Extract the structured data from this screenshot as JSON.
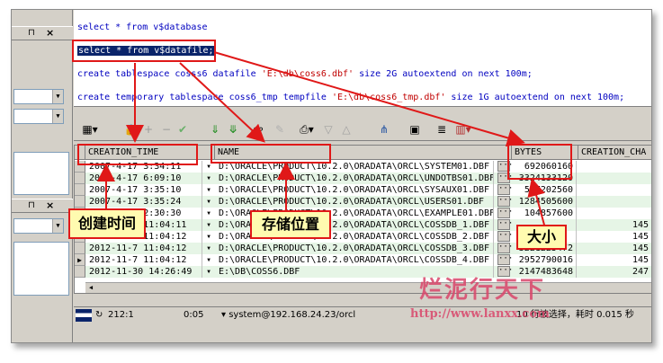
{
  "sql_editor": {
    "lines": [
      {
        "text": "select * from v$database"
      },
      {
        "text": "select * from v$datafile;"
      },
      {
        "kw1": "create tablespace cosss6 datafile ",
        "str": "'E:\\db\\coss6.dbf'",
        "kw2": " size 2G autoextend on next 100m;"
      },
      {
        "kw1": "create temporary tablespace coss6_tmp tempfile ",
        "str": "'E:\\db\\coss6_tmp.dbf'",
        "kw2": " size 1G autoextend on next 100m;"
      }
    ]
  },
  "grid": {
    "columns": [
      "CREATION_TIME",
      "NAME",
      "BYTES",
      "CREATION_CHA"
    ],
    "rows": [
      {
        "time": "2007-4-17 3:34:11",
        "name": "D:\\ORACLE\\PRODUCT\\10.2.0\\ORADATA\\ORCL\\SYSTEM01.DBF",
        "bytes": "692060160",
        "cha": ""
      },
      {
        "time": "2007-4-17 6:09:10",
        "name": "D:\\ORACLE\\PRODUCT\\10.2.0\\ORADATA\\ORCL\\UNDOTBS01.DBF",
        "bytes": "3324133120",
        "cha": ""
      },
      {
        "time": "2007-4-17 3:35:10",
        "name": "D:\\ORACLE\\PRODUCT\\10.2.0\\ORADATA\\ORCL\\SYSAUX01.DBF",
        "bytes": "587202560",
        "cha": ""
      },
      {
        "time": "2007-4-17 3:35:24",
        "name": "D:\\ORACLE\\PRODUCT\\10.2.0\\ORADATA\\ORCL\\USERS01.DBF",
        "bytes": "1284505600",
        "cha": ""
      },
      {
        "time": "2008-4-17 2:30:30",
        "name": "D:\\ORACLE\\PRODUCT\\10.2.0\\ORADATA\\ORCL\\EXAMPLE01.DBF",
        "bytes": "104857600",
        "cha": ""
      },
      {
        "time": "2012-11-7 11:04:11",
        "name": "D:\\ORACLE\\PRODUCT\\10.2.0\\ORADATA\\ORCL\\COSSDB_1.DBF",
        "bytes": "",
        "cha": "145"
      },
      {
        "time": "2012-11-7 11:04:12",
        "name": "D:\\ORACLE\\PRODUCT\\10.2.0\\ORADATA\\ORCL\\COSSDB_2.DBF",
        "bytes": "",
        "cha": "145"
      },
      {
        "time": "2012-11-7 11:04:12",
        "name": "D:\\ORACLE\\PRODUCT\\10.2.0\\ORADATA\\ORCL\\COSSDB_3.DBF",
        "bytes": "3221225472",
        "cha": "145"
      },
      {
        "time": "2012-11-7 11:04:12",
        "name": "D:\\ORACLE\\PRODUCT\\10.2.0\\ORADATA\\ORCL\\COSSDB_4.DBF",
        "bytes": "2952790016",
        "cha": "145"
      },
      {
        "time": "2012-11-30 14:26:49",
        "name": "E:\\DB\\COSS6.DBF",
        "bytes": "2147483648",
        "cha": "247"
      }
    ]
  },
  "status": {
    "position": "212:1",
    "time": "0:05",
    "connection": "system@192.168.24.23/orcl",
    "rows_selected": "10 行被选择，耗时 0.015 秒"
  },
  "callouts": {
    "creation_time": "创建时间",
    "location": "存储位置",
    "size": "大小"
  },
  "watermark": {
    "brand": "烂泥行天下",
    "url": "http://www.lanxx.com"
  },
  "colors": {
    "annotation_red": "#e01818",
    "callout_bg": "#fffbb0",
    "sql_blue": "#0000c0",
    "selection": "#0a246a",
    "row_alt": "#e6f5e6"
  }
}
